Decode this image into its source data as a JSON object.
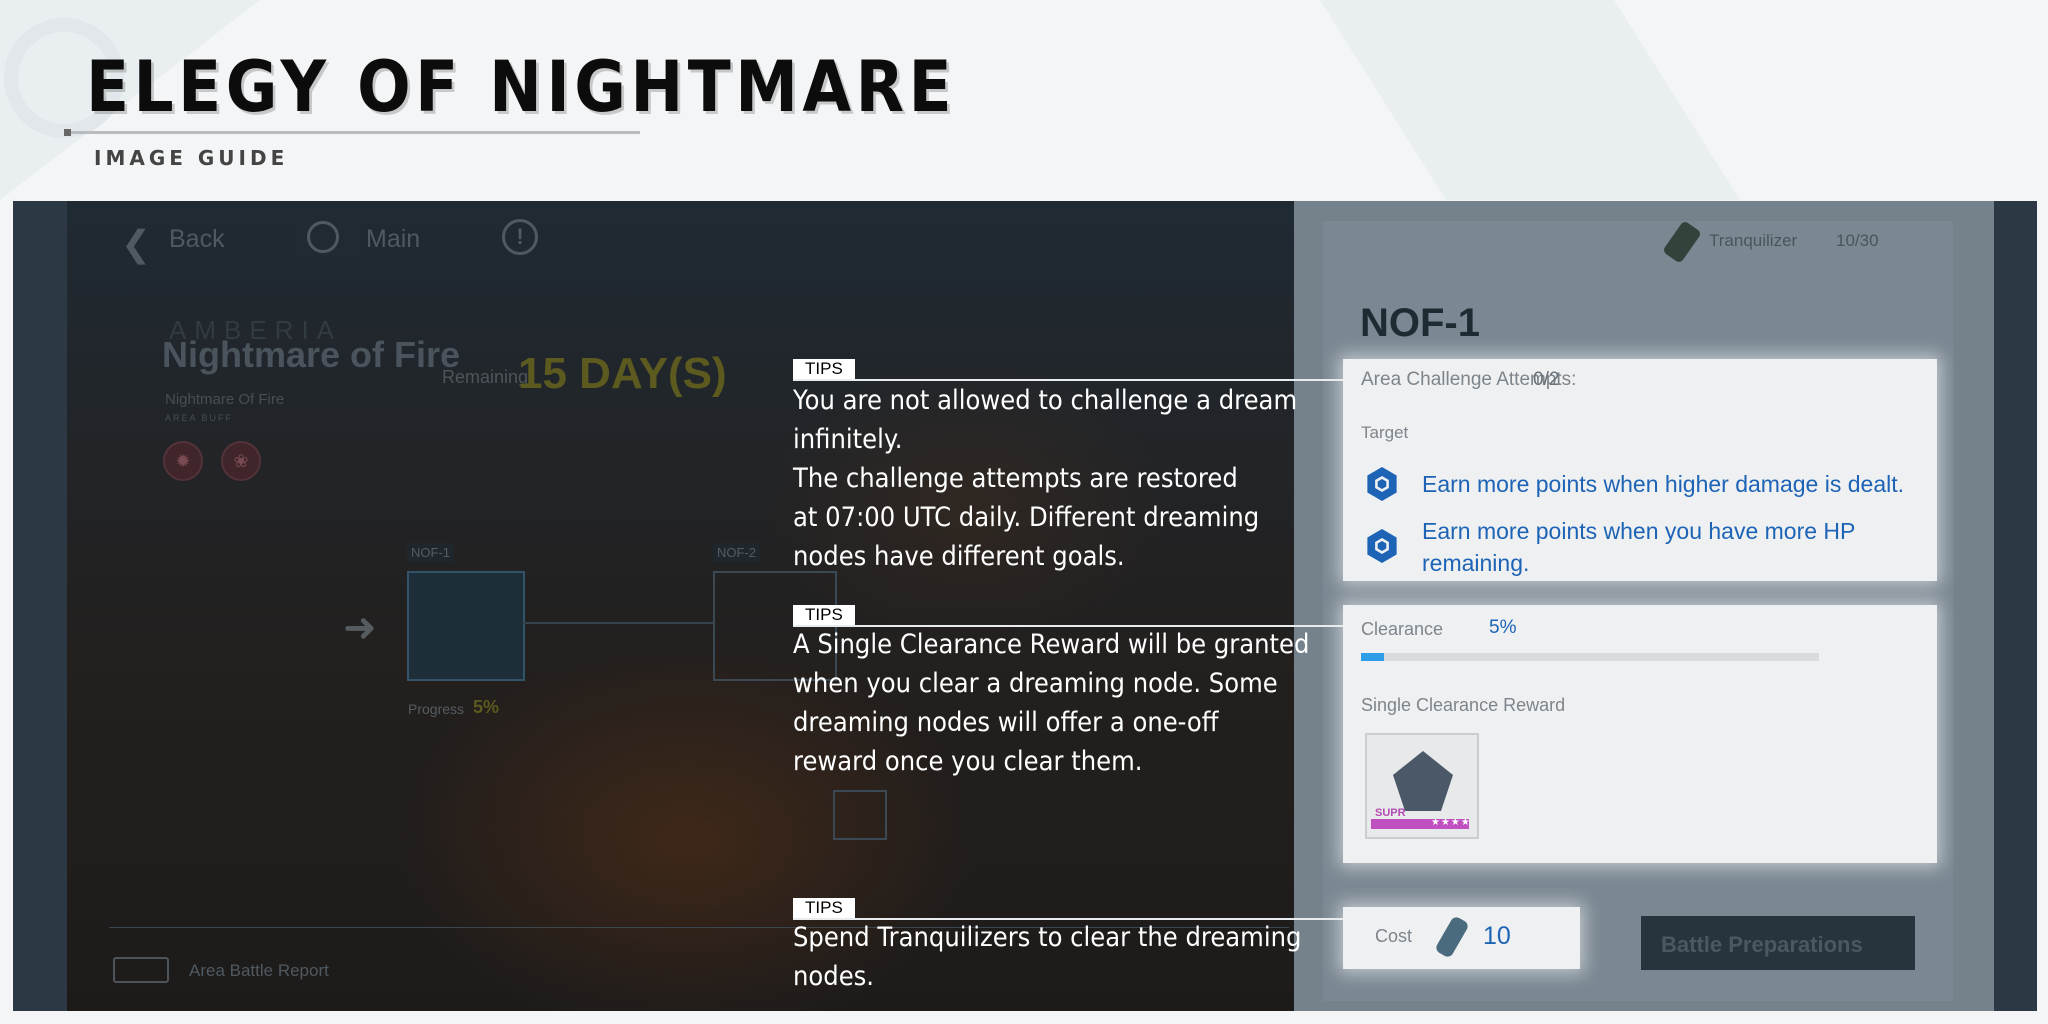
{
  "header": {
    "title": "ELEGY OF NIGHTMARE",
    "subtitle": "IMAGE GUIDE"
  },
  "game": {
    "nav": {
      "back_label": "Back",
      "main_label": "Main",
      "info_icon": "!"
    },
    "area": {
      "faded_heading": "AMBERIA",
      "name": "Nightmare of Fire",
      "subtitle": "Nightmare Of Fire",
      "buff_caption": "AREA BUFF",
      "remaining_label": "Remaining",
      "remaining_value": "15 DAY(S)",
      "buff_icons": [
        "burn-icon",
        "fire-emblem-icon"
      ]
    },
    "map": {
      "node1_label": "NOF-1",
      "node2_label": "NOF-2",
      "progress_label": "Progress",
      "progress_value": "5%"
    },
    "footer": {
      "report_label": "Area Battle Report"
    },
    "right": {
      "tranquilizer_label": "Tranquilizer",
      "tranquilizer_count": "10/30",
      "stage_title": "NOF-1",
      "attempts_label": "Area Challenge Attempts:",
      "attempts_value": "0/2",
      "target_label": "Target",
      "targets": [
        "Earn more points when higher damage is dealt.",
        "Earn more points when you have more HP\nremaining."
      ],
      "clearance_label": "Clearance",
      "clearance_value": "5%",
      "clearance_fraction": 0.05,
      "reward_label": "Single Clearance Reward",
      "reward_tag": "SUPR",
      "reward_stars": "★★★★",
      "cost_label": "Cost",
      "cost_value": "10",
      "battle_label": "Battle Preparations"
    }
  },
  "tips": [
    {
      "tag": "TIPS",
      "text": "You are not allowed to challenge a dream\ninfinitely.\nThe challenge attempts are restored\nat 07:00 UTC daily. Different dreaming\nnodes have different goals."
    },
    {
      "tag": "TIPS",
      "text": "A Single Clearance Reward will be granted\nwhen you clear a dreaming node. Some\ndreaming nodes will offer a one-off\nreward once you clear them."
    },
    {
      "tag": "TIPS",
      "text": "Spend Tranquilizers to clear the dreaming\nnodes."
    }
  ],
  "colors": {
    "accent_blue": "#1d63b6",
    "progress_blue": "#2f9ee8",
    "title_black": "#0c0c0c"
  }
}
